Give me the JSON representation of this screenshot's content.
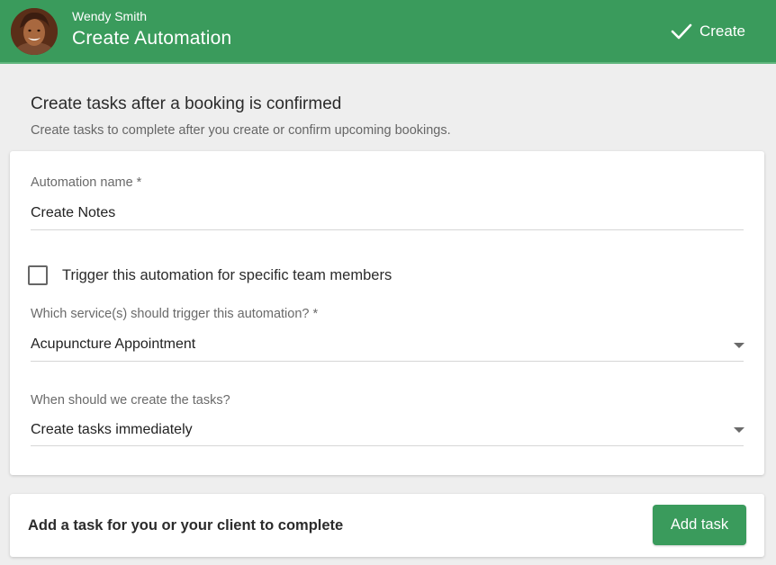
{
  "header": {
    "user_name": "Wendy Smith",
    "title": "Create Automation",
    "create_label": "Create",
    "background_color": "#3a9b5c"
  },
  "intro": {
    "title": "Create tasks after a booking is confirmed",
    "description": "Create tasks to complete after you create or confirm upcoming bookings."
  },
  "form": {
    "automation_name_label": "Automation name *",
    "automation_name_value": "Create Notes",
    "team_members_checkbox_label": "Trigger this automation for specific team members",
    "team_members_checked": false,
    "service_label": "Which service(s) should trigger this automation? *",
    "service_value": "Acupuncture Appointment",
    "timing_label": "When should we create the tasks?",
    "timing_value": "Create tasks immediately"
  },
  "tasks": {
    "title": "Add a task for you or your client to complete",
    "add_button_label": "Add task"
  },
  "icons": {
    "avatar": "user-avatar",
    "create": "checkmark-icon",
    "dropdown": "caret-down-icon"
  }
}
